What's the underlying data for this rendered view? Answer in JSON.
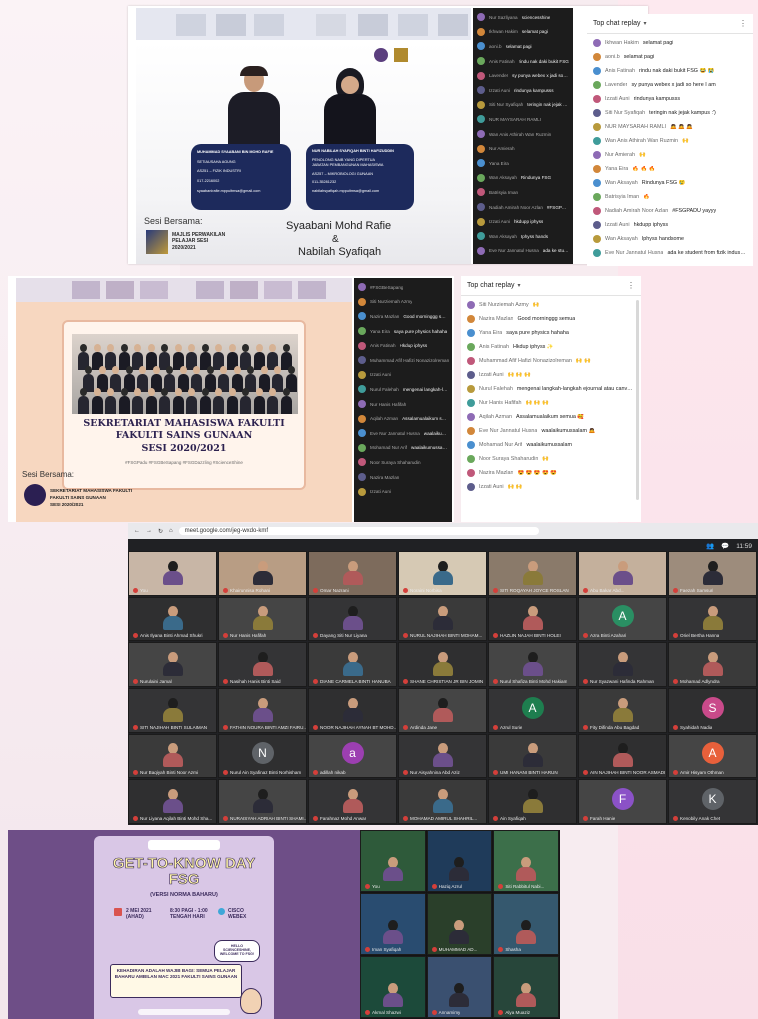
{
  "panel1": {
    "slide": {
      "left_person": {
        "name": "MUHAMMAD SYAABANI BIN MOHD RAFIE",
        "role": "SETIAUSAHA AGUNG",
        "program": "AS251 – FIZIK INDUSTRI",
        "phone": "017-2216002",
        "email": "syaabanirafie.mppuitmsa@gmail.com"
      },
      "right_person": {
        "name": "NUR NABILAH SYAFIQAH BINTI HAFIZUDDIN",
        "role": "PENOLONG NAIB YANG DIPERTUA",
        "role2": "JABATAN PEMBANGUNAN MAHASISWA",
        "program": "AS257 – MIKROBIOLOGI GUNAAN",
        "phone": "011-35281232",
        "email": "nabilahsyafiqah.mppuitmsa@gmail.com"
      },
      "session_label": "Sesi Bersama:",
      "org": "MAJLIS PERWAKILAN PELAJAR SESI 2020/2021",
      "host1": "Syaabani Mohd Rafie",
      "amp": "&",
      "host2": "Nabilah Syafiqah"
    },
    "dark_chat": [
      {
        "name": "Nur Sazliyana",
        "msg": "sciencesshine"
      },
      {
        "name": "Ikhwan Hakim",
        "msg": "selamat pagi"
      },
      {
        "name": "aoni.b",
        "msg": "selamat pagi"
      },
      {
        "name": "Anis Fatinah",
        "msg": "rindu nak daki bukit FSG"
      },
      {
        "name": "Lavender",
        "msg": "sy punya webex x jadi so here I am"
      },
      {
        "name": "Izzati Auni",
        "msg": "rindunya kampusss"
      },
      {
        "name": "Siti Nur Syafiqah",
        "msg": "teringin nak jejak kampus"
      },
      {
        "name": "NUR MAYSARAH RAMLI",
        "msg": ""
      },
      {
        "name": "Wan Anis Athirah Wan Ruzmin",
        "msg": ""
      },
      {
        "name": "Nur Amierah",
        "msg": ""
      },
      {
        "name": "Yana Eira",
        "msg": ""
      },
      {
        "name": "Wan Aksayah",
        "msg": "Rindunya FSG"
      },
      {
        "name": "Batrisyia Iman",
        "msg": ""
      },
      {
        "name": "Nadiah Amirah Noor Azlan",
        "msg": "#FSGPADU yayyy"
      },
      {
        "name": "Izzati Auni",
        "msg": "hkdupp iphyss"
      },
      {
        "name": "Wan Aksayah",
        "msg": "Iphyss hands"
      },
      {
        "name": "Eve Nur Jannatul Husna",
        "msg": "ada ke student from fizik industri"
      }
    ],
    "replay": {
      "title": "Top chat replay",
      "messages": [
        {
          "name": "Ikhwan Hakim",
          "msg": "selamat pagi"
        },
        {
          "name": "aoni.b",
          "msg": "selamat pagi"
        },
        {
          "name": "Anis Fatinah",
          "msg": "rindu nak daki bukit FSG 😂 😭"
        },
        {
          "name": "Lavender",
          "msg": "sy punya webex x jadi so here I am"
        },
        {
          "name": "Izzati Auni",
          "msg": "rindunya kampusss"
        },
        {
          "name": "Siti Nur Syafiqah",
          "msg": "teringin nak jejak kampus :')"
        },
        {
          "name": "NUR MAYSARAH RAMLI",
          "msg": "🙇 🙇 🙇"
        },
        {
          "name": "Wan Anis Athirah Wan Ruzmin",
          "msg": "🙌"
        },
        {
          "name": "Nur Amierah",
          "msg": "🙌"
        },
        {
          "name": "Yana Eira",
          "msg": "🔥 🔥 🔥"
        },
        {
          "name": "Wan Aksayah",
          "msg": "Rindunya FSG 😢"
        },
        {
          "name": "Batrisyia Iman",
          "msg": "🔥"
        },
        {
          "name": "Nadiah Amirah Noor Azlan",
          "msg": "#FSGPADU yayyy"
        },
        {
          "name": "Izzati Auni",
          "msg": "hkdupp iphyss"
        },
        {
          "name": "Wan Aksayah",
          "msg": "Iphyss handsome"
        },
        {
          "name": "Eve Nur Jannatul Husna",
          "msg": "ada ke student from fizik industri??"
        }
      ]
    }
  },
  "panel2": {
    "slide": {
      "title1": "SEKRETARIAT MAHASISWA FAKULTI",
      "title2": "FAKULTI SAINS GUNAAN",
      "title3": "SESI 2020/2021",
      "hashtags": "#FSGPadu #FSGBeSapang #FSGDazzling #ScienceShine",
      "session_label": "Sesi Bersama:",
      "org1": "SEKRETARIAT MAHASISWA FAKULTI",
      "org2": "FAKULTI SAINS GUNAAN",
      "org3": "SESI 2020/2021"
    },
    "dark_chat": [
      {
        "name": "#FSGBeSapang",
        "msg": ""
      },
      {
        "name": "Siti Nurziemah Azmy",
        "msg": ""
      },
      {
        "name": "Nazira Mazlan",
        "msg": "Good morninggg semua"
      },
      {
        "name": "Yana Eira",
        "msg": "saya pure physics hahaha"
      },
      {
        "name": "Anis Fatinah",
        "msg": "Hkdup iphyss"
      },
      {
        "name": "Muhammad Afif Hafizi Nonazizolreman",
        "msg": ""
      },
      {
        "name": "Izzati Auni",
        "msg": ""
      },
      {
        "name": "Nurul Falehah",
        "msg": "mengenai langkah-langkah ejournal atau canva, korang boleh check di ig smf fsg"
      },
      {
        "name": "Nur Hanis Hafifah",
        "msg": ""
      },
      {
        "name": "Aqilah Azman",
        "msg": "Assalamualaikum semua"
      },
      {
        "name": "Eve Nur Jannatul Husna",
        "msg": "waalaikumussalam"
      },
      {
        "name": "Mohamad Nur Arif",
        "msg": "waalaikumussalam"
      },
      {
        "name": "Noor Suraya Shaharudin",
        "msg": ""
      },
      {
        "name": "Nazira Mazlan",
        "msg": ""
      },
      {
        "name": "Izzati Auni",
        "msg": ""
      }
    ],
    "replay": {
      "title": "Top chat replay",
      "messages": [
        {
          "name": "Siti Nurziemah Azmy",
          "msg": "🙌"
        },
        {
          "name": "Nazira Mazlan",
          "msg": "Good morninggg semua"
        },
        {
          "name": "Yana Eira",
          "msg": "saya pure physics hahaha"
        },
        {
          "name": "Anis Fatinah",
          "msg": "Hkdup iphyss ✨"
        },
        {
          "name": "Muhammad Afif Hafizi Nonazizolreman",
          "msg": "🙌 🙌"
        },
        {
          "name": "Izzati Auni",
          "msg": "🙌 🙌 🙌"
        },
        {
          "name": "Nurul Falehah",
          "msg": "mengenai langkah-langkah ejournal atau canva, korang boleh check di ig smf fsg 🙌"
        },
        {
          "name": "Nur Hanis Hafifah",
          "msg": "🙌 🙌 🙌"
        },
        {
          "name": "Aqilah Azman",
          "msg": "Assalamualaikum semua 🥰"
        },
        {
          "name": "Eve Nur Jannatul Husna",
          "msg": "waalaikumussalam 🙇"
        },
        {
          "name": "Mohamad Nur Arif",
          "msg": "waalaikumussalam"
        },
        {
          "name": "Noor Suraya Shaharudin",
          "msg": "🙌"
        },
        {
          "name": "Nazira Mazlan",
          "msg": "😍 😍 😍 😍 😍"
        },
        {
          "name": "Izzati Auni",
          "msg": "🙌 🙌"
        }
      ]
    }
  },
  "panel3": {
    "url": "meet.google.com/jeg-wxdo-kmf",
    "clock": "11:59",
    "rows": [
      [
        "You",
        "Khairunnisa Rohani",
        "Omar Nazrani",
        "Noraini Norbisa",
        "SITI ROQAYAH JOYCE ROSLAN",
        "Abu Bakar Abd...",
        "Faezah Samsuri"
      ],
      [
        "Anis Ilyana Binti Ahmad Shukri",
        "Nur Hanis Hafifah",
        "Dayang Siti Nur Liyana",
        "NURUL NAJIHAH BINTI MOHAM...",
        "HAZLIN NAJAH BINTI HOLEI",
        "Azra Binti Azahari",
        "Oriel Bertha Hanna"
      ],
      [
        "Nurulaini Jamal",
        "Nasihah Hanis Binti Said",
        "DIANE CARMELA BINTI HANUBA",
        "SHANE CHRISTIAN JR BIN JOMIN",
        "Nurul Shafiza Binti Mohd Hakiam",
        "Nur Syazwani Hafinda Rahman",
        "Mohamad Adlyndra"
      ],
      [
        "SITI NAJIHAH BINTI SULAIMAN",
        "FATHIN NOURA BINTI AMZI FAIRU...",
        "NOOR NAJIHAH AYNAH BT MOHD...",
        "Ardinda Jane",
        "Azrul Surie",
        "Fity Difinda Abu Bagdad",
        "Syahidah Nadia"
      ],
      [
        "Nur Baqiyah Binti Noor Azmi",
        "Nurul Ain Syafinaz Binti Norhisham",
        "adillah nikab",
        "Nur Aisyahnina Abd Aziz",
        "UMI HANANI BINTI HARUN",
        "AIN NAJIHAH BINTI NOOR ASMADI",
        "Amir Hisyam Othman"
      ],
      [
        "Nur Liyana Aqilah Binti Mohd Sha...",
        "NURAISYAH ADRIAH BINTI SHAMI...",
        "Farahnaz Mohd Anwar",
        "MOHAMAD AMIRUL SHAHRIL...",
        "Ain Syafiqah",
        "Farah Hanie",
        "Kenobily Anak Chet"
      ]
    ],
    "letters": {
      "A": "A",
      "N": "N",
      "a": "a",
      "S": "S",
      "K": "K",
      "F": "F"
    }
  },
  "panel4": {
    "poster": {
      "title": "GET-TO-KNOW DAY FSG",
      "subtitle": "(VERSI NORMA BAHARU)",
      "date": "2 MEI 2021 (AHAD)",
      "time": "8:30 PAGI - 1:00 TENGAH HARI",
      "platform": "CISCO WEBEX",
      "notice": "KEHADIRAN ADALAH WAJIB BAGI: SEMUA PELAJAR BAHARU AMBILAN MAC 2021 FAKULTI SAINS GUNAAN",
      "bubble": "HELLO SCIENCESHINE, WELCOME TO FSG!"
    },
    "gallery": [
      {
        "name": "You"
      },
      {
        "name": "Haziq Azrul"
      },
      {
        "name": "Siti Rabbitul Nabi..."
      },
      {
        "name": "Iman Syafiqah"
      },
      {
        "name": "MUHAMMAD AD..."
      },
      {
        "name": "Shasha"
      },
      {
        "name": "Akmal Shazwi"
      },
      {
        "name": "Annamimy"
      },
      {
        "name": "Alya Muaziz"
      }
    ]
  },
  "colors": {
    "dark_chat_bg": "#1c1c1c",
    "slide_navy": "#1d2a5c",
    "meet_bg": "#202124",
    "poster_purple": "#6e4e87",
    "accent_blue": "#3e66b7"
  }
}
